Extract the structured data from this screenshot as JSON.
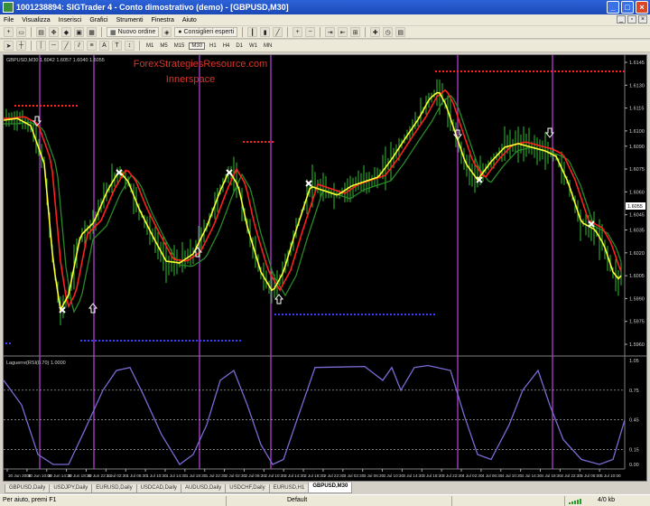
{
  "window": {
    "title": "1001238894: SIGTrader 4 - Conto dimostrativo (demo) - [GBPUSD,M30]",
    "minimize_glyph": "_",
    "maximize_glyph": "□",
    "close_glyph": "×"
  },
  "menu": [
    "File",
    "Visualizza",
    "Inserisci",
    "Grafici",
    "Strumenti",
    "Finestra",
    "Aiuto"
  ],
  "toolbar": {
    "new_order_label": "Nuovo ordine",
    "expert_advisors_label": "Consiglieri esperti",
    "timeframes": [
      "M1",
      "M5",
      "M15",
      "M30",
      "H1",
      "H4",
      "D1",
      "W1",
      "MN"
    ],
    "active_timeframe": "M30"
  },
  "chart": {
    "header": "GBPUSD,M30  1.6042 1.6057 1.6040 1.6055",
    "watermark_line1": "ForexStrategiesResource.com",
    "watermark_line2": "Innerspace",
    "current_price": "1.6055",
    "price_ticks": [
      "1.6145",
      "1.6130",
      "1.6115",
      "1.6100",
      "1.6090",
      "1.6075",
      "1.6060",
      "1.6045",
      "1.6035",
      "1.6020",
      "1.6005",
      "1.5990",
      "1.5975",
      "1.5960"
    ],
    "indicator_header": "Laguerre(RSI(0.70) 1.0000",
    "indicator_ticks": [
      "1.05",
      "0.75",
      "0.45",
      "0.15",
      "0.00"
    ],
    "time_labels": [
      "30 Jun 2008",
      "30 Jun 10:00",
      "30 Jun 14:30",
      "30 Jun 18:30",
      "30 Jun 22:30",
      "1 Jul 02:30",
      "1 Jul 06:30",
      "1 Jul 10:30",
      "1 Jul 14:30",
      "1 Jul 18:30",
      "1 Jul 22:30",
      "2 Jul 02:30",
      "2 Jul 06:30",
      "2 Jul 10:30",
      "2 Jul 14:30",
      "2 Jul 18:30",
      "2 Jul 22:30",
      "3 Jul 02:30",
      "3 Jul 06:30",
      "3 Jul 10:30",
      "3 Jul 14:30",
      "3 Jul 18:30",
      "3 Jul 22:30",
      "4 Jul 02:30",
      "4 Jul 06:30",
      "4 Jul 10:30",
      "4 Jul 14:30",
      "4 Jul 18:30",
      "4 Jul 22:30",
      "5 Jul 06:00",
      "5 Jul 10:00"
    ],
    "colors": {
      "background": "#000000",
      "bars": "#2fbf2f",
      "fast_line": "#ffff33",
      "slow_line": "#ff2020",
      "signal_line": "#2a8a2a",
      "session_lines": "#b040d0",
      "indicator_line": "#7b6bd6",
      "resistance_dots": "#ff2020",
      "support_dots": "#3a3aff"
    }
  },
  "tabs": [
    "GBPUSD,Daily",
    "USDJPY,Daily",
    "EURUSD,Daily",
    "USDCAD,Daily",
    "AUDUSD,Daily",
    "USDCHF,Daily",
    "EURUSD,H1",
    "GBPUSD,M30"
  ],
  "active_tab": "GBPUSD,M30",
  "status": {
    "help": "Per aiuto, premi F1",
    "profile": "Default",
    "traffic": "4/0 kb"
  }
}
